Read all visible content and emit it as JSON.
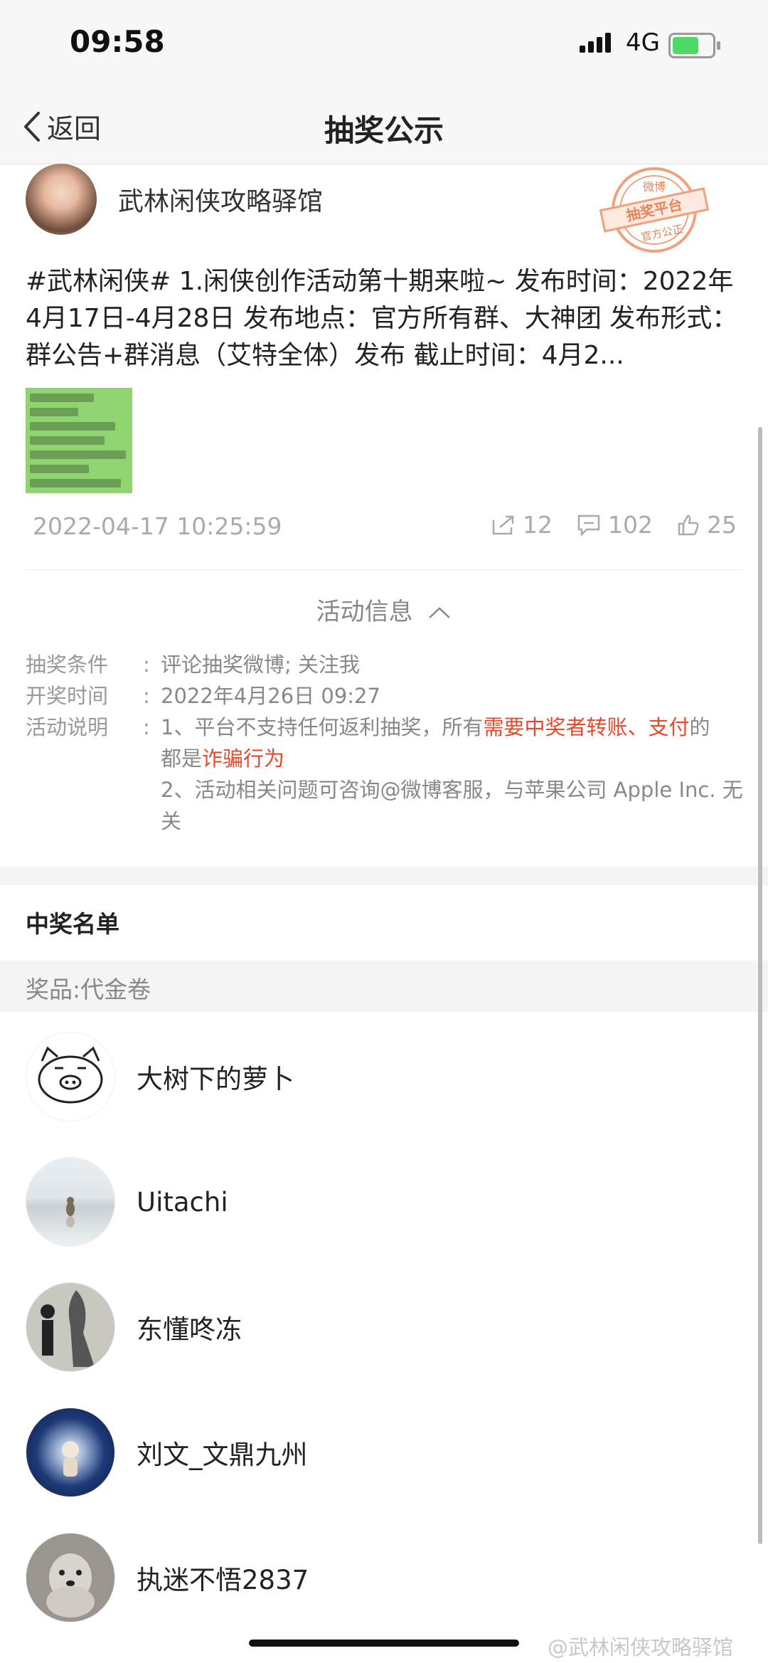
{
  "status": {
    "time": "09:58",
    "network": "4G"
  },
  "nav": {
    "back_label": "返回",
    "title": "抽奖公示"
  },
  "author": {
    "name": "武林闲侠攻略驿馆"
  },
  "stamp": {
    "top": "微博",
    "middle": "抽奖平台",
    "bottom": "官方公正"
  },
  "post": {
    "text": "#武林闲侠# 1.闲侠创作活动第十期来啦~ 发布时间：2022年4月17日-4月28日 发布地点：官方所有群、大神团 发布形式：群公告+群消息（艾特全体）发布 截止时间：4月2...",
    "timestamp": "2022-04-17 10:25:59",
    "reposts": "12",
    "comments": "102",
    "likes": "25"
  },
  "activity": {
    "toggle_label": "活动信息",
    "rows": [
      {
        "label": "抽奖条件",
        "value": "评论抽奖微博; 关注我"
      },
      {
        "label": "开奖时间",
        "value": "2022年4月26日 09:27"
      },
      {
        "label": "活动说明",
        "line1_a": "1、平台不支持任何返利抽奖，所有",
        "line1_red": "需要中奖者转账、支付",
        "line1_b": "的",
        "line2_a": "都是",
        "line2_red": "诈骗行为",
        "line3": "2、活动相关问题可咨询@微博客服，与苹果公司 Apple Inc. 无关"
      }
    ]
  },
  "winners_section": {
    "title": "中奖名单",
    "prize": "奖品:代金卷",
    "winners": [
      {
        "name": "大树下的萝卜"
      },
      {
        "name": "Uitachi"
      },
      {
        "name": "东懂咚冻"
      },
      {
        "name": "刘文_文鼎九州"
      },
      {
        "name": "执迷不悟2837"
      }
    ]
  },
  "watermark": "@武林闲侠攻略驿馆",
  "colors": {
    "accent_red": "#e6492d",
    "secondary_text": "#999999"
  }
}
